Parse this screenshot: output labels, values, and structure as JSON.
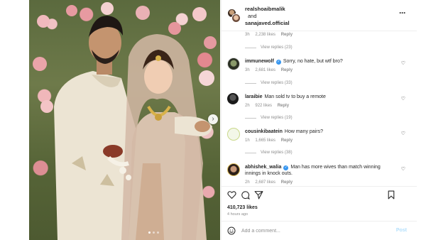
{
  "post": {
    "header": {
      "author1": "realshoaibmalik",
      "connector": "and",
      "author2": "sanajaved.official"
    },
    "likes": "410,723 likes",
    "time_ago": "4 hours ago"
  },
  "thread_top": {
    "time": "3h",
    "likes": "2,238 likes",
    "reply": "Reply",
    "view_replies": "View replies (23)"
  },
  "comments": [
    {
      "username": "immunewolf",
      "verified": true,
      "text": "Sorry, no hate, but wtf bro?",
      "time": "3h",
      "likes": "2,681 likes",
      "reply": "Reply",
      "view_replies": "View replies (33)"
    },
    {
      "username": "laraibie",
      "verified": false,
      "text": "Man sold tv to buy a remote",
      "time": "2h",
      "likes": "922 likes",
      "reply": "Reply",
      "view_replies": "View replies (19)"
    },
    {
      "username": "cousinkibaatein",
      "verified": false,
      "text": "How many pairs?",
      "time": "1h",
      "likes": "1,665 likes",
      "reply": "Reply",
      "view_replies": "View replies (38)"
    },
    {
      "username": "abhishek_walia",
      "verified": true,
      "text": "Man has more wives than match winning innings in knock outs.",
      "time": "2h",
      "likes": "2,687 likes",
      "reply": "Reply"
    }
  ],
  "add_comment": {
    "placeholder": "Add a comment...",
    "post_label": "Post"
  },
  "icons": {
    "more": "more-options-icon",
    "heart": "heart-icon",
    "comment": "comment-icon",
    "share": "share-icon",
    "save": "bookmark-icon",
    "emoji": "emoji-icon",
    "next": "chevron-right-icon"
  },
  "colors": {
    "link_blue": "#3897f0",
    "post_disabled": "#b2dffc",
    "muted_text": "#8e8e8e"
  }
}
